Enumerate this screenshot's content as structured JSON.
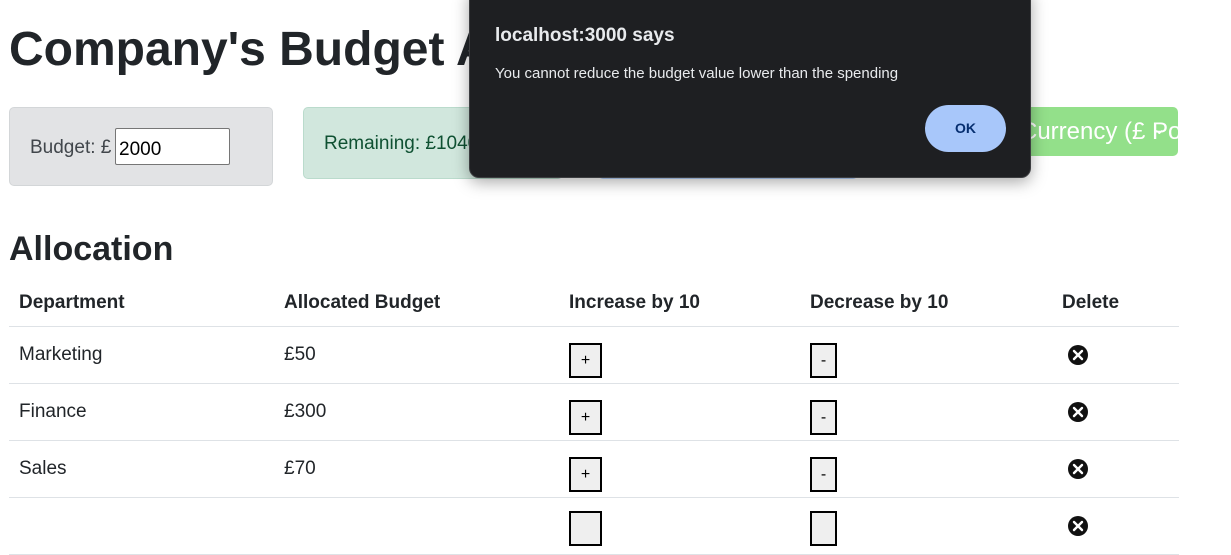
{
  "page": {
    "title": "Company's Budget Allocation"
  },
  "budget": {
    "label": "Budget: £",
    "value": "2000"
  },
  "remaining": {
    "label": "Remaining: £1040"
  },
  "currency": {
    "selected": "Currency (£ Pound)",
    "color": "#93e08a"
  },
  "allocation": {
    "title": "Allocation",
    "columns": [
      "Department",
      "Allocated Budget",
      "Increase by 10",
      "Decrease by 10",
      "Delete"
    ],
    "rows": [
      {
        "department": "Marketing",
        "budget": "£50",
        "inc": "+",
        "dec": "-"
      },
      {
        "department": "Finance",
        "budget": "£300",
        "inc": "+",
        "dec": "-"
      },
      {
        "department": "Sales",
        "budget": "£70",
        "inc": "+",
        "dec": "-"
      },
      {
        "department": "",
        "budget": "",
        "inc": "",
        "dec": ""
      }
    ]
  },
  "dialog": {
    "title": "localhost:3000 says",
    "message": "You cannot reduce the budget value lower than the spending",
    "ok_label": "OK"
  },
  "icons": {
    "delete": "close-circle-icon",
    "chevron": "chevron-down-icon"
  }
}
